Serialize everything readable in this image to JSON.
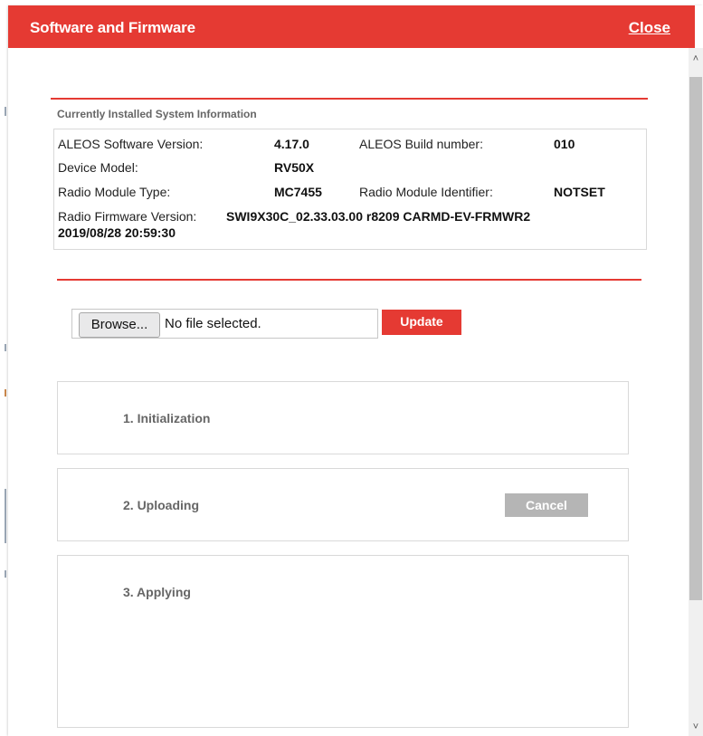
{
  "dialog": {
    "title": "Software and Firmware",
    "close_label": "Close"
  },
  "system_info": {
    "heading": "Currently Installed System Information",
    "aleos_software_version_label": "ALEOS Software Version:",
    "aleos_software_version": "4.17.0",
    "aleos_build_number_label": "ALEOS Build number:",
    "aleos_build_number": "010",
    "device_model_label": "Device Model:",
    "device_model": "RV50X",
    "radio_module_type_label": "Radio Module Type:",
    "radio_module_type": "MC7455",
    "radio_module_identifier_label": "Radio Module Identifier:",
    "radio_module_identifier": "NOTSET",
    "radio_firmware_version_label": "Radio Firmware Version:",
    "radio_firmware_version_line1": "SWI9X30C_02.33.03.00 r8209 CARMD-EV-FRMWR2",
    "radio_firmware_version_line2": "2019/08/28 20:59:30"
  },
  "upload": {
    "browse_label": "Browse...",
    "file_status": "No file selected.",
    "update_label": "Update"
  },
  "steps": [
    {
      "label": "1. Initialization"
    },
    {
      "label": "2. Uploading",
      "cancel_label": "Cancel"
    },
    {
      "label": "3. Applying"
    }
  ],
  "colors": {
    "accent": "#e53a33",
    "disabled_button": "#b5b5b5"
  }
}
